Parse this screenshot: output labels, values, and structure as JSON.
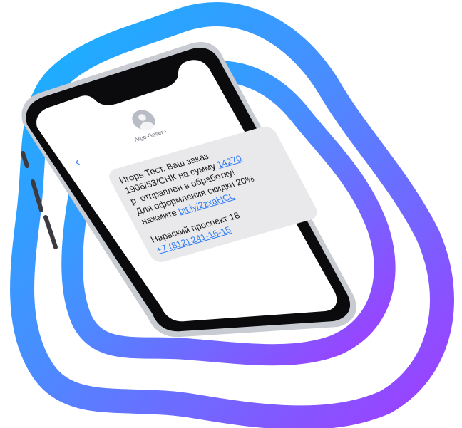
{
  "colors": {
    "blob_gradient_start": "#12b6ff",
    "blob_gradient_mid": "#4a8cff",
    "blob_gradient_end": "#a13cff",
    "phone_frame": "#0b0b0e",
    "screen_bg": "#ffffff",
    "bubble_bg": "#e9e9eb",
    "link": "#2f7cf6"
  },
  "icons": {
    "avatar": "person-icon",
    "back": "chevron-left-icon"
  },
  "sms": {
    "sender": "Argo-Geser ›",
    "back_label": "‹",
    "line1": "Игорь Тест, Ваш заказ",
    "line2_pre": "1906/53/СНК на сумму ",
    "line2_link": "14270",
    "line3": "р. отправлен в обработку!",
    "line4": "Для оформления скидки 20%",
    "line5_pre": "нажмите ",
    "line5_link": "bit.ly/2zxaHCL",
    "address": "Нарвский проспект 18",
    "phone": "+7 (812) 241-16-15"
  }
}
